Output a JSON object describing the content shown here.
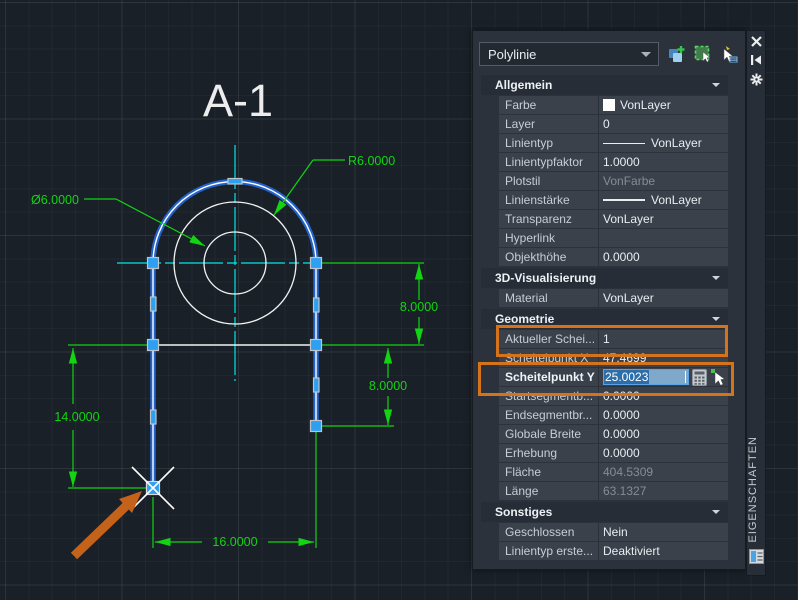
{
  "drawing": {
    "title": "A-1",
    "labels": {
      "radius": "R6.0000",
      "diameter": "Ø6.0000",
      "right_upper": "8.0000",
      "right_lower": "8.0000",
      "left": "14.0000",
      "bottom": "16.0000"
    },
    "colors": {
      "dimension_green": "#12d412",
      "selection_blue": "#2563cc",
      "crosshair_cyan": "#00e5e5",
      "grip_blue": "#2ea0f2",
      "annotation_orange": "#c4621a",
      "highlight_orange": "#d4731a"
    }
  },
  "palette": {
    "selector": {
      "value": "Polylinie"
    },
    "icons": {
      "pickadd": "pickadd-toggle",
      "quick_select": "quick-select",
      "select_objects": "select-objects",
      "close": "close",
      "auto_hide": "auto-hide",
      "settings": "settings",
      "calculator": "calculator",
      "pick_point": "pick-point",
      "palette_window": "properties-palette"
    },
    "title_vertical": "EIGENSCHAFTEN",
    "sections": [
      {
        "label": "Allgemein",
        "rows": [
          {
            "label": "Farbe",
            "value": "VonLayer"
          },
          {
            "label": "Layer",
            "value": "0"
          },
          {
            "label": "Linientyp",
            "value": "VonLayer"
          },
          {
            "label": "Linientypfaktor",
            "value": "1.0000"
          },
          {
            "label": "Plotstil",
            "value": "VonFarbe"
          },
          {
            "label": "Linienstärke",
            "value": "VonLayer"
          },
          {
            "label": "Transparenz",
            "value": "VonLayer"
          },
          {
            "label": "Hyperlink",
            "value": ""
          },
          {
            "label": "Objekthöhe",
            "value": "0.0000"
          }
        ]
      },
      {
        "label": "3D-Visualisierung",
        "rows": [
          {
            "label": "Material",
            "value": "VonLayer"
          }
        ]
      },
      {
        "label": "Geometrie",
        "rows": [
          {
            "label": "Aktueller Schei...",
            "value": "1"
          },
          {
            "label": "Scheitelpunkt X",
            "value": "47.4699"
          },
          {
            "label": "Scheitelpunkt Y",
            "value": "25.0023"
          },
          {
            "label": "Startsegmentb...",
            "value": "0.0000"
          },
          {
            "label": "Endsegmentbr...",
            "value": "0.0000"
          },
          {
            "label": "Globale Breite",
            "value": "0.0000"
          },
          {
            "label": "Erhebung",
            "value": "0.0000"
          },
          {
            "label": "Fläche",
            "value": "404.5309"
          },
          {
            "label": "Länge",
            "value": "63.1327"
          }
        ]
      },
      {
        "label": "Sonstiges",
        "rows": [
          {
            "label": "Geschlossen",
            "value": "Nein"
          },
          {
            "label": "Linientyp erste...",
            "value": "Deaktiviert"
          }
        ]
      }
    ]
  }
}
